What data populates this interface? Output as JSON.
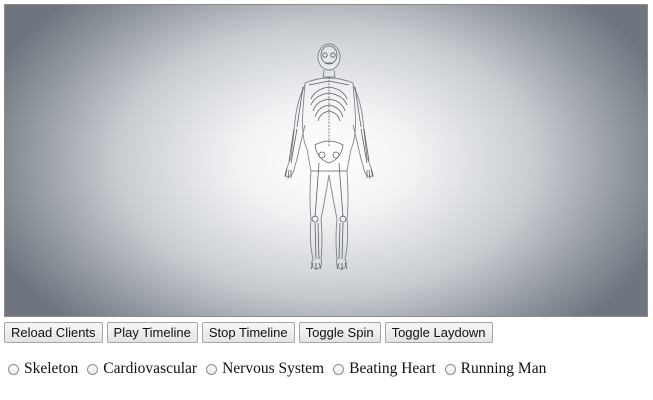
{
  "viewer": {
    "model_icon": "human-anatomy-wireframe"
  },
  "controls": {
    "reload_clients": "Reload Clients",
    "play_timeline": "Play Timeline",
    "stop_timeline": "Stop Timeline",
    "toggle_spin": "Toggle Spin",
    "toggle_laydown": "Toggle Laydown"
  },
  "radios": {
    "skeleton": {
      "label": "Skeleton",
      "checked": false
    },
    "cardiovascular": {
      "label": "Cardiovascular",
      "checked": false
    },
    "nervous_system": {
      "label": "Nervous System",
      "checked": false
    },
    "beating_heart": {
      "label": "Beating Heart",
      "checked": false
    },
    "running_man": {
      "label": "Running Man",
      "checked": false
    }
  }
}
